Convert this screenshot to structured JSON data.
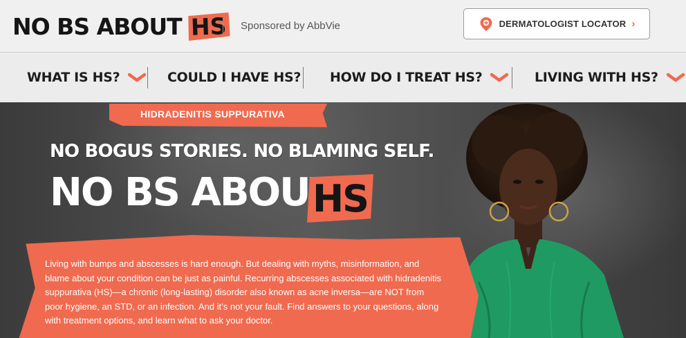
{
  "header": {
    "logo_text": "NO BS ABOUT",
    "logo_hs": "HS",
    "sponsor": "Sponsored by AbbVie",
    "locator_label": "DERMATOLOGIST LOCATOR",
    "locator_chevron": "›",
    "locator_icon": "map-pin-icon"
  },
  "nav": {
    "items": [
      {
        "label": "WHAT IS HS?",
        "has_dropdown": true
      },
      {
        "label": "COULD I HAVE HS?",
        "has_dropdown": false
      },
      {
        "label": "HOW DO I TREAT HS?",
        "has_dropdown": true
      },
      {
        "label": "LIVING WITH HS?",
        "has_dropdown": true
      }
    ]
  },
  "hero": {
    "tag": "HIDRADENITIS SUPPURATIVA",
    "subtitle": "NO BOGUS STORIES. NO BLAMING SELF.",
    "title": "NO BS ABOUT",
    "title_hs": "HS",
    "body": "Living with bumps and abscesses is hard enough. But dealing with myths, misinformation, and blame about your condition can be just as painful. Recurring abscesses associated with hidradenitis suppurativa (HS)—a chronic (long-lasting) disorder also known as acne inversa—are NOT from poor hygiene, an STD, or an infection. And it’s not your fault. Find answers to your questions, along with treatment options, and learn what to ask your doctor."
  },
  "colors": {
    "accent": "#f06a4f",
    "nav_bg": "#ececec",
    "text_dark": "#1c1c1c",
    "blouse": "#1f9a62"
  }
}
